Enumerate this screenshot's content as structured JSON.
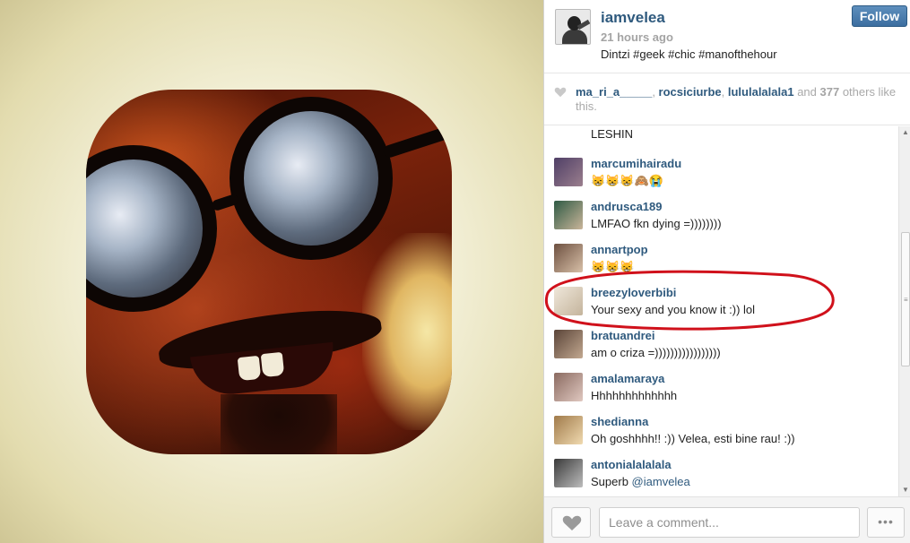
{
  "post": {
    "username": "iamvelea",
    "timestamp": "21 hours ago",
    "caption": "Dintzi #geek #chic #manofthehour",
    "follow_label": "Follow"
  },
  "likes": {
    "users": [
      "ma_ri_a_____",
      "rocsiciurbe",
      "lululalalala1"
    ],
    "sep": ", ",
    "and_text": " and ",
    "count": "377",
    "suffix": " others like this."
  },
  "comments": {
    "partial_top": "LESHIN",
    "items": [
      {
        "user": "marcumihairadu",
        "text": "😸😸😸🙈😭",
        "avatar_color": "#6a5a78"
      },
      {
        "user": "andrusca189",
        "text": "LMFAO fkn dying =))))))))",
        "avatar_color": "#4a6b5a"
      },
      {
        "user": "annartpop",
        "text": "😸😸😸",
        "avatar_color": "#8a6e5a"
      },
      {
        "user": "breezyloverbibi",
        "text": "Your sexy and you know it :)) lol",
        "avatar_color": "#d9cfc0"
      },
      {
        "user": "bratuandrei",
        "text": "am o criza =)))))))))))))))))",
        "avatar_color": "#9a8270"
      },
      {
        "user": "amalamaraya",
        "text": "Hhhhhhhhhhhhh",
        "avatar_color": "#b89a90"
      },
      {
        "user": "shedianna",
        "text": "Oh goshhhh!! :)) Velea, esti bine rau! :))",
        "avatar_color": "#c5a57a"
      },
      {
        "user": "antonialalalala",
        "text": "Superb ",
        "mention": "@iamvelea",
        "avatar_color": "#6a6a6a"
      }
    ]
  },
  "comment_box": {
    "placeholder": "Leave a comment...",
    "more_label": "•••"
  },
  "colors": {
    "link": "#2f5a7e",
    "follow_bg": "#3c6ea0",
    "highlight": "#d0111b"
  },
  "icons": {
    "like": "heart-icon",
    "more": "ellipsis-icon"
  }
}
